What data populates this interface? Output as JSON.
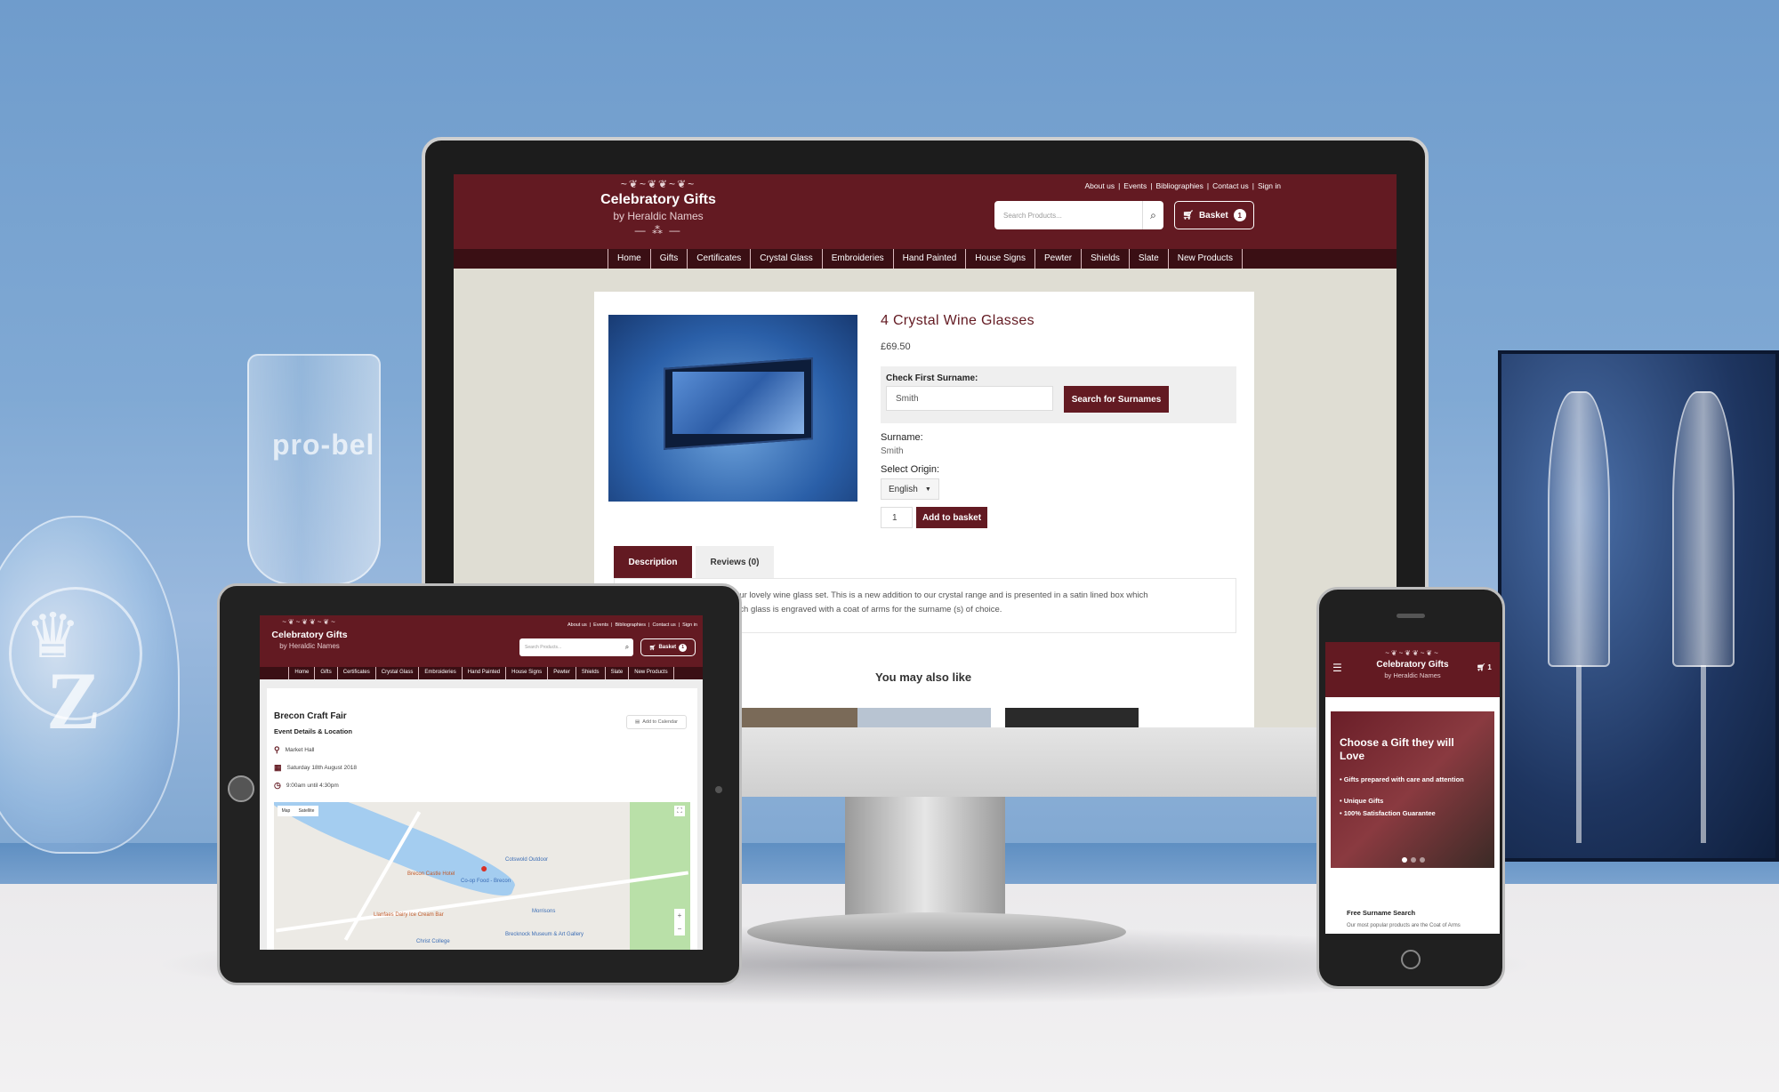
{
  "site": {
    "logo_title": "Celebratory Gifts",
    "logo_sub": "by Heraldic Names",
    "logo_flourish": "~❦~❦❦~❦~"
  },
  "header": {
    "top_links": [
      "About us",
      "Events",
      "Bibliographies",
      "Contact us",
      "Sign in"
    ],
    "search_placeholder": "Search Products...",
    "basket_label": "Basket",
    "basket_count": "1"
  },
  "nav": {
    "items": [
      "Home",
      "Gifts",
      "Certificates",
      "Crystal Glass",
      "Embroideries",
      "Hand Painted",
      "House Signs",
      "Pewter",
      "Shields",
      "Slate",
      "New Products"
    ]
  },
  "product": {
    "title": "4 Crystal Wine Glasses",
    "price": "£69.50",
    "check_label": "Check First Surname:",
    "surname_input": "Smith",
    "search_button": "Search for Surnames",
    "surname_label": "Surname:",
    "surname_value": "Smith",
    "origin_label": "Select Origin:",
    "origin_value": "English",
    "quantity": "1",
    "add_button": "Add to basket",
    "tabs": [
      "Description",
      "Reviews (0)"
    ],
    "description_line1": "our lovely wine glass set.  This is a new addition to our crystal range and is presented in a satin lined box which",
    "description_line2": "ach glass is engraved with a coat of arms for the surname (s) of choice.",
    "also_like": "You may also like"
  },
  "event": {
    "title": "Brecon Craft Fair",
    "subtitle": "Event Details & Location",
    "add_calendar": "Add to Calendar",
    "location": "Market Hall",
    "date": "Saturday 18th August 2018",
    "time": "9:00am until 4:30pm",
    "map_toggle": [
      "Map",
      "Satellite"
    ],
    "map_labels": [
      "Cotswold Outdoor",
      "Co-op Food - Brecon",
      "Morrisons",
      "Brecknock Museum & Art Gallery",
      "Brecon Castle Hotel",
      "Llanfaes Dairy Ice Cream Bar",
      "Christ College"
    ]
  },
  "mobile": {
    "hero_title": "Choose a Gift they will Love",
    "bullets": [
      "• Gifts prepared with care and attention",
      "• Unique Gifts",
      "• 100% Satisfaction Guarantee"
    ],
    "cart_count": "1",
    "free_surname_title": "Free Surname Search",
    "free_surname_text": "Our most popular products are the Coat of Arms"
  },
  "decor": {
    "glass_engraving": "pro-bel",
    "award_letter": "Z"
  },
  "colors": {
    "brand": "#631a22",
    "nav_dark": "#3a0f14",
    "page_bg": "#dfddd3"
  }
}
